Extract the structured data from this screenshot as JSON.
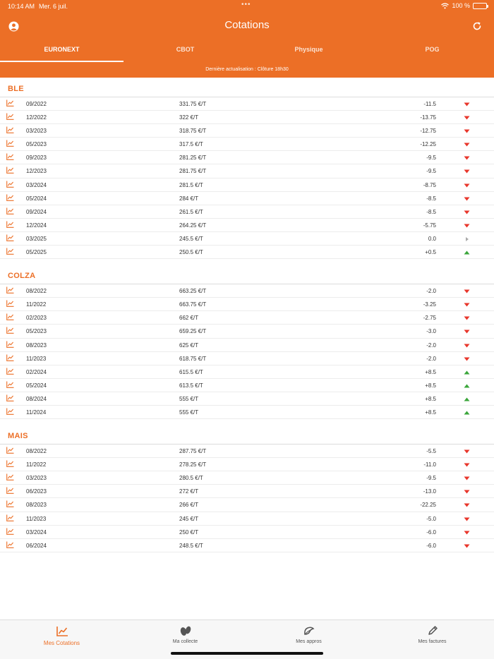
{
  "status_bar": {
    "time": "10:14 AM",
    "date": "Mer. 6 juil.",
    "dots": "•••",
    "battery": "100 %"
  },
  "header": {
    "title": "Cotations"
  },
  "tabs": [
    {
      "label": "EURONEXT",
      "active": true
    },
    {
      "label": "CBOT",
      "active": false
    },
    {
      "label": "Physique",
      "active": false
    },
    {
      "label": "POG",
      "active": false
    }
  ],
  "update_text": "Dernière actualisation : Clôture 18h30",
  "colors": {
    "accent": "#ec6f26",
    "down": "#e8362b",
    "up": "#3aa63a",
    "neutral": "#aaaaaa"
  },
  "sections": [
    {
      "title": "BLE",
      "rows": [
        {
          "date": "09/2022",
          "price": "331.75 €/T",
          "change": "-11.5",
          "trend": "down"
        },
        {
          "date": "12/2022",
          "price": "322 €/T",
          "change": "-13.75",
          "trend": "down"
        },
        {
          "date": "03/2023",
          "price": "318.75 €/T",
          "change": "-12.75",
          "trend": "down"
        },
        {
          "date": "05/2023",
          "price": "317.5 €/T",
          "change": "-12.25",
          "trend": "down"
        },
        {
          "date": "09/2023",
          "price": "281.25 €/T",
          "change": "-9.5",
          "trend": "down"
        },
        {
          "date": "12/2023",
          "price": "281.75 €/T",
          "change": "-9.5",
          "trend": "down"
        },
        {
          "date": "03/2024",
          "price": "281.5 €/T",
          "change": "-8.75",
          "trend": "down"
        },
        {
          "date": "05/2024",
          "price": "284 €/T",
          "change": "-8.5",
          "trend": "down"
        },
        {
          "date": "09/2024",
          "price": "261.5 €/T",
          "change": "-8.5",
          "trend": "down"
        },
        {
          "date": "12/2024",
          "price": "264.25 €/T",
          "change": "-5.75",
          "trend": "down"
        },
        {
          "date": "03/2025",
          "price": "245.5 €/T",
          "change": "0.0",
          "trend": "neutral"
        },
        {
          "date": "05/2025",
          "price": "250.5 €/T",
          "change": "+0.5",
          "trend": "up"
        }
      ]
    },
    {
      "title": "COLZA",
      "rows": [
        {
          "date": "08/2022",
          "price": "663.25 €/T",
          "change": "-2.0",
          "trend": "down"
        },
        {
          "date": "11/2022",
          "price": "663.75 €/T",
          "change": "-3.25",
          "trend": "down"
        },
        {
          "date": "02/2023",
          "price": "662 €/T",
          "change": "-2.75",
          "trend": "down"
        },
        {
          "date": "05/2023",
          "price": "659.25 €/T",
          "change": "-3.0",
          "trend": "down"
        },
        {
          "date": "08/2023",
          "price": "625 €/T",
          "change": "-2.0",
          "trend": "down"
        },
        {
          "date": "11/2023",
          "price": "618.75 €/T",
          "change": "-2.0",
          "trend": "down"
        },
        {
          "date": "02/2024",
          "price": "615.5 €/T",
          "change": "+8.5",
          "trend": "up"
        },
        {
          "date": "05/2024",
          "price": "613.5 €/T",
          "change": "+8.5",
          "trend": "up"
        },
        {
          "date": "08/2024",
          "price": "555 €/T",
          "change": "+8.5",
          "trend": "up"
        },
        {
          "date": "11/2024",
          "price": "555 €/T",
          "change": "+8.5",
          "trend": "up"
        }
      ]
    },
    {
      "title": "MAIS",
      "rows": [
        {
          "date": "08/2022",
          "price": "287.75 €/T",
          "change": "-5.5",
          "trend": "down"
        },
        {
          "date": "11/2022",
          "price": "278.25 €/T",
          "change": "-11.0",
          "trend": "down"
        },
        {
          "date": "03/2023",
          "price": "280.5 €/T",
          "change": "-9.5",
          "trend": "down"
        },
        {
          "date": "06/2023",
          "price": "272 €/T",
          "change": "-13.0",
          "trend": "down"
        },
        {
          "date": "08/2023",
          "price": "266 €/T",
          "change": "-22.25",
          "trend": "down"
        },
        {
          "date": "11/2023",
          "price": "245 €/T",
          "change": "-5.0",
          "trend": "down"
        },
        {
          "date": "03/2024",
          "price": "250 €/T",
          "change": "-6.0",
          "trend": "down"
        },
        {
          "date": "06/2024",
          "price": "248.5 €/T",
          "change": "-6.0",
          "trend": "down"
        }
      ]
    }
  ],
  "bottom_nav": [
    {
      "label": "Mes Cotations",
      "icon": "chart-line-icon",
      "active": true
    },
    {
      "label": "Ma collecte",
      "icon": "grain-icon",
      "active": false
    },
    {
      "label": "Mes appros",
      "icon": "seed-bag-icon",
      "active": false
    },
    {
      "label": "Mes factures",
      "icon": "pen-icon",
      "active": false
    }
  ]
}
